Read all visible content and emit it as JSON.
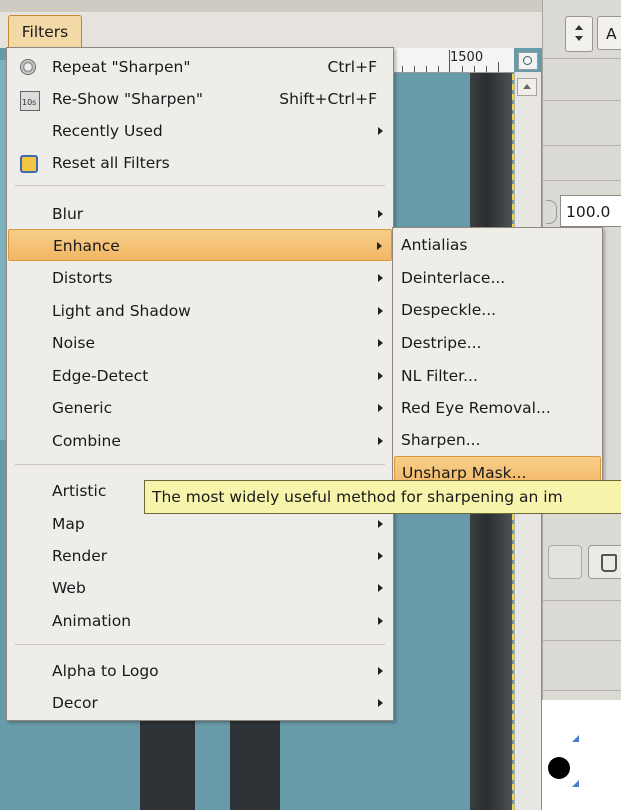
{
  "menubar": {
    "filters_label": "Filters"
  },
  "ruler": {
    "mark": "1500"
  },
  "dock": {
    "mode_value": "A",
    "opacity_value": "100.0"
  },
  "main_menu": {
    "items": [
      {
        "label": "Repeat \"Sharpen\"",
        "accel": "Ctrl+F",
        "icon": "repeat-filter-icon"
      },
      {
        "label": "Re-Show \"Sharpen\"",
        "accel": "Shift+Ctrl+F",
        "icon": "reshow-filter-icon"
      },
      {
        "label": "Recently Used",
        "submenu": true
      },
      {
        "label": "Reset all Filters",
        "icon": "reset-filters-icon"
      },
      {
        "label": "Blur",
        "submenu": true
      },
      {
        "label": "Enhance",
        "submenu": true,
        "highlighted": true
      },
      {
        "label": "Distorts",
        "submenu": true
      },
      {
        "label": "Light and Shadow",
        "submenu": true
      },
      {
        "label": "Noise",
        "submenu": true
      },
      {
        "label": "Edge-Detect",
        "submenu": true
      },
      {
        "label": "Generic",
        "submenu": true
      },
      {
        "label": "Combine",
        "submenu": true
      },
      {
        "label": "Artistic",
        "submenu": true
      },
      {
        "label": "Map",
        "submenu": true
      },
      {
        "label": "Render",
        "submenu": true
      },
      {
        "label": "Web",
        "submenu": true
      },
      {
        "label": "Animation",
        "submenu": true
      },
      {
        "label": "Alpha to Logo",
        "submenu": true
      },
      {
        "label": "Decor",
        "submenu": true
      }
    ]
  },
  "enhance_submenu": {
    "items": [
      {
        "label": "Antialias"
      },
      {
        "label": "Deinterlace..."
      },
      {
        "label": "Despeckle..."
      },
      {
        "label": "Destripe..."
      },
      {
        "label": "NL Filter..."
      },
      {
        "label": "Red Eye Removal..."
      },
      {
        "label": "Sharpen..."
      },
      {
        "label": "Unsharp Mask...",
        "highlighted": true
      }
    ]
  },
  "tooltip": {
    "text": "The most widely useful method for sharpening an im"
  },
  "colors": {
    "highlight": "#f2b664",
    "tooltip_bg": "#f6f5ab",
    "canvas": "#689ba9"
  }
}
